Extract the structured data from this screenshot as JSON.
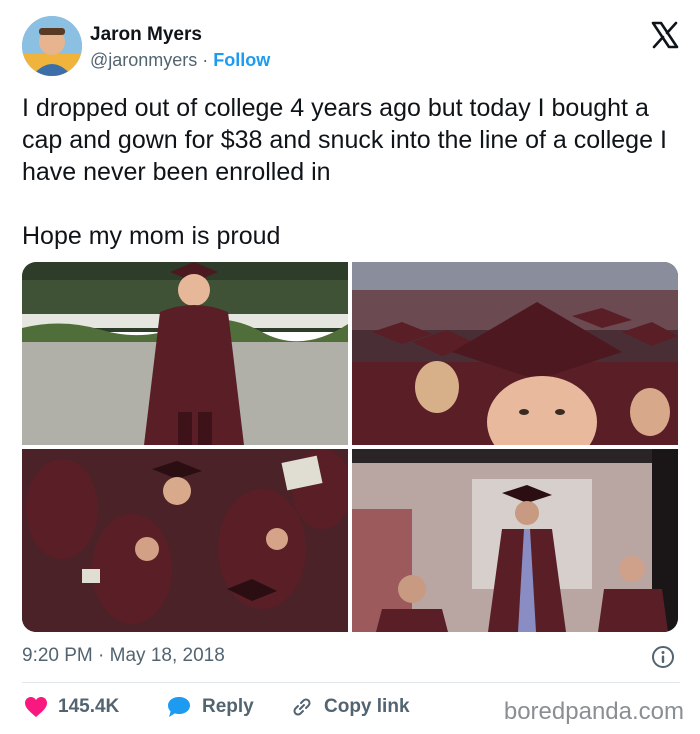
{
  "author": {
    "name": "Jaron Myers",
    "handle": "@jaronmyers",
    "separator": " · ",
    "follow_label": "Follow"
  },
  "tweet": {
    "text": "I dropped out of college 4 years ago but today I bought a cap and gown for $38 and snuck into the line of a college I have never been enrolled in\n\nHope my mom is proud",
    "timestamp": "9:20 PM · May 18, 2018"
  },
  "actions": {
    "likes": "145.4K",
    "reply_label": "Reply",
    "copy_label": "Copy link"
  },
  "watermark": "boredpanda.com",
  "colors": {
    "like": "#f91880",
    "reply": "#1d9bf0",
    "link": "#1d9bf0",
    "gown": "#5a1e26"
  },
  "icons": [
    "x-logo-icon",
    "info-icon",
    "heart-icon",
    "reply-bubble-icon",
    "link-icon"
  ]
}
